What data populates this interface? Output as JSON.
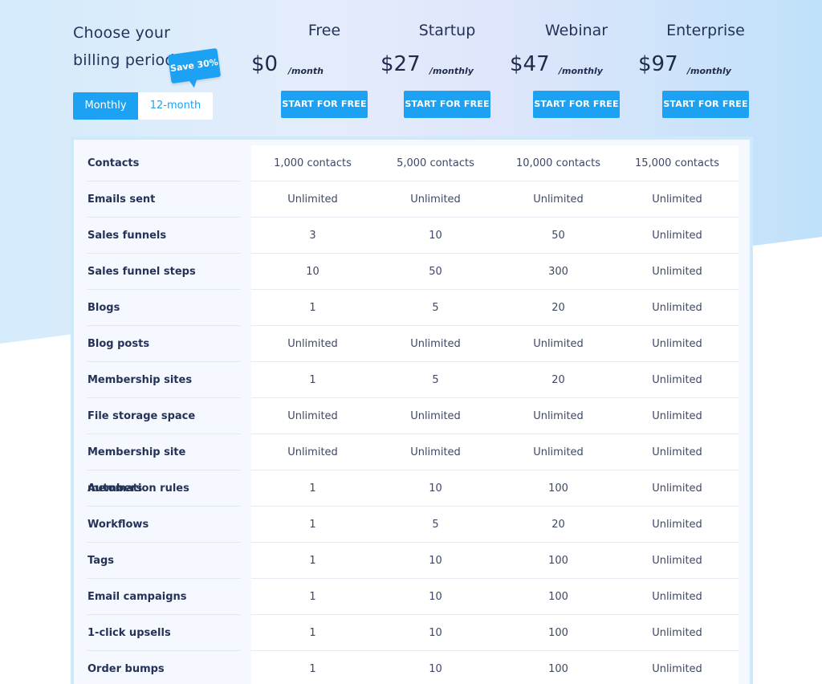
{
  "billing": {
    "title_line1": "Choose your",
    "title_line2": "billing period",
    "save_badge": "Save 30%",
    "monthly_label": "Monthly",
    "yearly_label": "12-month"
  },
  "plans": [
    {
      "name": "Free",
      "price": "$0",
      "unit": "/month",
      "button": "START FOR FREE"
    },
    {
      "name": "Startup",
      "price": "$27",
      "unit": "/monthly",
      "button": "START FOR FREE"
    },
    {
      "name": "Webinar",
      "price": "$47",
      "unit": "/monthly",
      "button": "START FOR FREE"
    },
    {
      "name": "Enterprise",
      "price": "$97",
      "unit": "/monthly",
      "button": "START FOR FREE"
    }
  ],
  "features": [
    {
      "label": "Contacts",
      "values": [
        "1,000 contacts",
        "5,000 contacts",
        "10,000 contacts",
        "15,000 contacts"
      ]
    },
    {
      "label": "Emails sent",
      "values": [
        "Unlimited",
        "Unlimited",
        "Unlimited",
        "Unlimited"
      ]
    },
    {
      "label": "Sales funnels",
      "values": [
        "3",
        "10",
        "50",
        "Unlimited"
      ]
    },
    {
      "label": "Sales funnel steps",
      "values": [
        "10",
        "50",
        "300",
        "Unlimited"
      ]
    },
    {
      "label": "Blogs",
      "values": [
        "1",
        "5",
        "20",
        "Unlimited"
      ]
    },
    {
      "label": "Blog posts",
      "values": [
        "Unlimited",
        "Unlimited",
        "Unlimited",
        "Unlimited"
      ]
    },
    {
      "label": "Membership sites",
      "values": [
        "1",
        "5",
        "20",
        "Unlimited"
      ]
    },
    {
      "label": "File storage space",
      "values": [
        "Unlimited",
        "Unlimited",
        "Unlimited",
        "Unlimited"
      ]
    },
    {
      "label": "Membership site members",
      "values": [
        "Unlimited",
        "Unlimited",
        "Unlimited",
        "Unlimited"
      ]
    },
    {
      "label": "Automation rules",
      "values": [
        "1",
        "10",
        "100",
        "Unlimited"
      ]
    },
    {
      "label": "Workflows",
      "values": [
        "1",
        "5",
        "20",
        "Unlimited"
      ]
    },
    {
      "label": "Tags",
      "values": [
        "1",
        "10",
        "100",
        "Unlimited"
      ]
    },
    {
      "label": "Email campaigns",
      "values": [
        "1",
        "10",
        "100",
        "Unlimited"
      ]
    },
    {
      "label": "1-click upsells",
      "values": [
        "1",
        "10",
        "100",
        "Unlimited"
      ]
    },
    {
      "label": "Order bumps",
      "values": [
        "1",
        "10",
        "100",
        "Unlimited"
      ]
    }
  ],
  "colors": {
    "accent": "#1da1f2",
    "text_dark": "#1f2a4d"
  }
}
